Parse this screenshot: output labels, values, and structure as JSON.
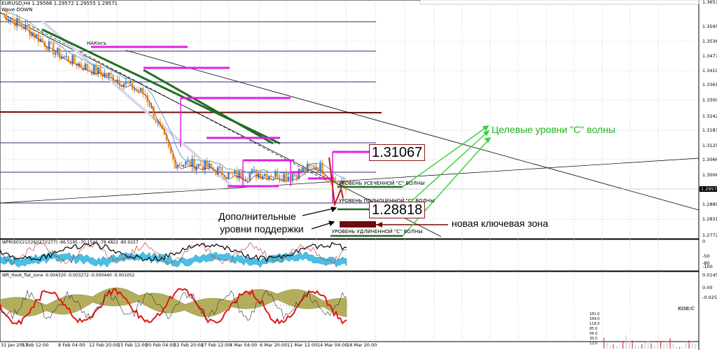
{
  "header": {
    "symbol": "EURUSD,H4",
    "ohlc": "1.29566 1.29572 1.29555 1.29571",
    "subtitle": "Wave DOWN"
  },
  "annotations": {
    "nakoch": "НАКосъ",
    "target_levels": "Целевые уровни \"С\" волны",
    "support_l1": "Дополнительные",
    "support_l2": "уровни поддержки",
    "key_zone": "новая ключевая зона",
    "level_short": "УРОВЕНЬ УСЕЧЕННОЙ \"С\" ВОЛНЫ",
    "level_full": "УРОВЕНЬ ПОЛНОЦЕННОЙ \"С\" ВОЛНЫ",
    "level_ext": "УРОВЕНЬ УДЛИНЕННОЙ \"С\" ВОЛНЫ",
    "box_high": "1.31067",
    "box_low": "1.28818"
  },
  "price_axis": {
    "ticks": [
      "1.36534",
      "1.35951",
      "1.35362",
      "1.34779",
      "1.34196",
      "1.33613",
      "1.33009",
      "1.32424",
      "1.31839",
      "1.31254",
      "1.30669",
      "1.30069",
      "1.29571",
      "1.28899",
      "1.28314",
      "1.27729"
    ],
    "current": "1.29571"
  },
  "osc1_axis": {
    "title": "WPR(60)(21)(26)(27)(277) -66.5185 -70.1546 -78.4822 -80.9157",
    "ticks": [
      "0",
      "-50",
      "-80",
      "-100"
    ]
  },
  "osc2_axis": {
    "title": "WR_Hook_flat_zone -0.004320 -0.003272 -0.000440 -0.001052",
    "ticks": [
      "0.014502",
      "0.00",
      "-0.025017"
    ]
  },
  "vol_axis": {
    "ticks": [
      "181.0",
      "169.0",
      "118.0",
      "85.0",
      "56.0",
      "35.0",
      "13.0"
    ],
    "brand": "KOB/C"
  },
  "x_axis": {
    "ticks": [
      "31 Jan 2013",
      "5 Feb 12:00",
      "8 Feb 04:00",
      "12 Feb 20:00",
      "15 Feb 12:00",
      "20 Feb 04:00",
      "22 Feb 20:00",
      "27 Feb 12:00",
      "4 Mar 04:00",
      "6 Mar 20:00",
      "11 Mar 12:00",
      "14 Mar 04:00",
      "18 Mar 20:00"
    ]
  },
  "colors": {
    "bull": "#3f7fc0",
    "bear": "#f0962a",
    "magenta": "#e020e0",
    "dark_green": "#1f6e1f",
    "dark_red": "#6e0b0b",
    "light_green": "#3ad23a",
    "wpr_fill": "#2ab4e0",
    "hook_fill": "#9b9b32",
    "hook_line": "#e01818"
  },
  "chart_data": {
    "type": "candlestick",
    "title": "EURUSD,H4",
    "x_categories": [
      "31 Jan 2013",
      "5 Feb 12:00",
      "8 Feb 04:00",
      "12 Feb 20:00",
      "15 Feb 12:00",
      "20 Feb 04:00",
      "22 Feb 20:00",
      "27 Feb 12:00",
      "4 Mar 04:00",
      "6 Mar 20:00",
      "11 Mar 12:00",
      "14 Mar 04:00",
      "18 Mar 20:00"
    ],
    "ylim": [
      1.277,
      1.368
    ],
    "close_path_at_ticks": [
      1.363,
      1.356,
      1.347,
      1.342,
      1.338,
      1.332,
      1.306,
      1.305,
      1.301,
      1.302,
      1.301,
      1.305,
      1.2957
    ],
    "last_close": 1.29571,
    "levels": [
      {
        "name": "УРОВЕНЬ УСЕЧЕННОЙ \"С\" ВОЛНЫ",
        "value": 1.297
      },
      {
        "name": "УРОВЕНЬ ПОЛНОЦЕННОЙ \"С\" ВОЛНЫ",
        "value": 1.289
      },
      {
        "name": "УРОВЕНЬ УДЛИНЕННОЙ \"С\" ВОЛНЫ",
        "value": 1.2755
      }
    ],
    "boxed_prices": [
      1.31067,
      1.28818
    ]
  }
}
